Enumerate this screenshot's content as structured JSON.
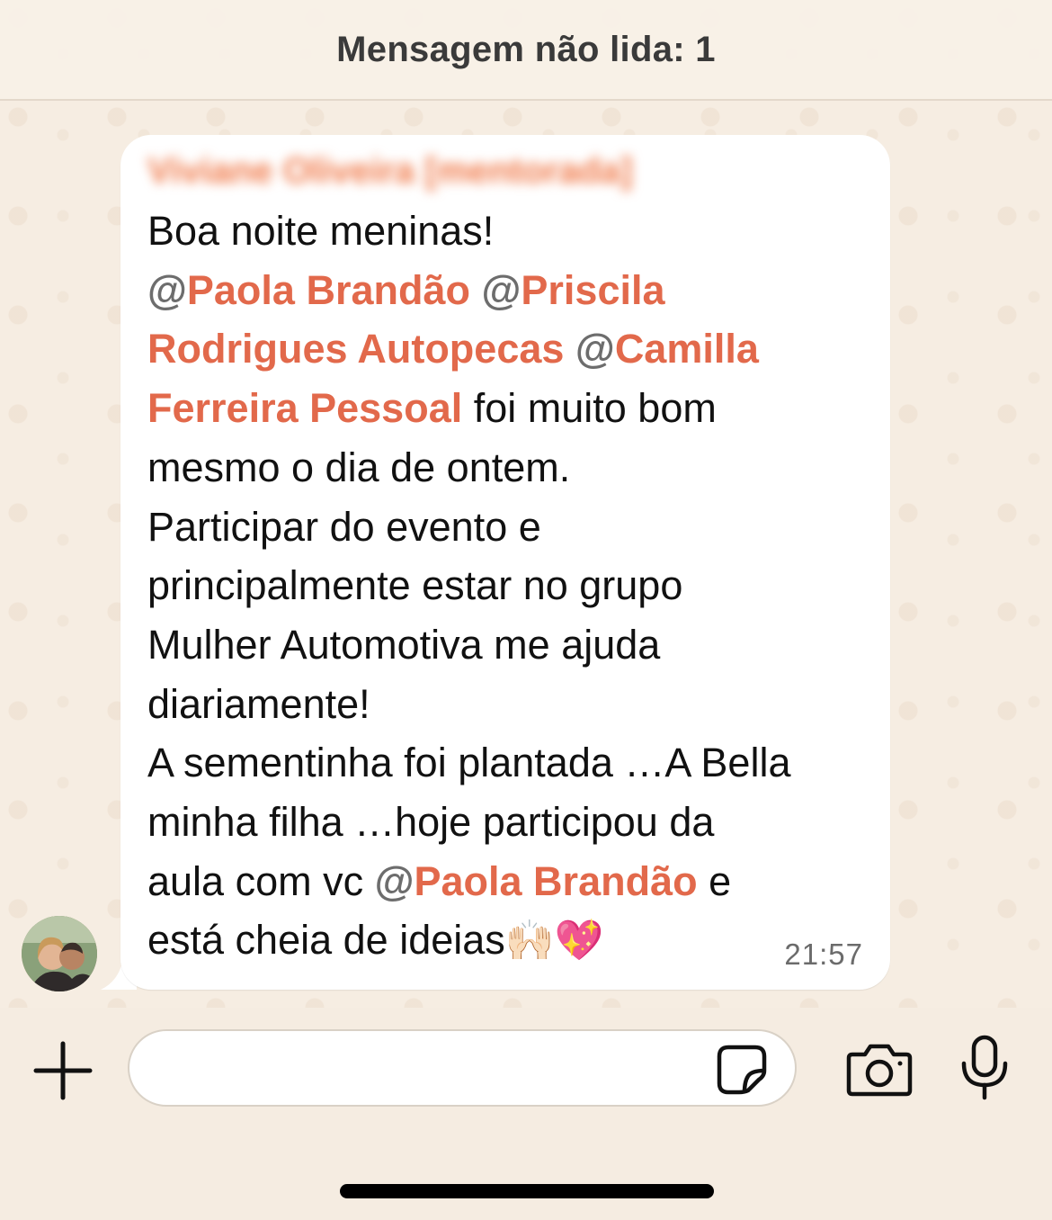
{
  "unread_banner": {
    "label": "Mensagem não lida: 1"
  },
  "message": {
    "sender": "Viviane Oliveira [mentorada]",
    "line1": "Boa noite meninas!",
    "mention_at": "@",
    "mention_paola": "Paola Brandão",
    "mention_priscila_1": "Priscila",
    "mention_priscila_2": "Rodrigues Autopecas",
    "mention_camilla_1": "Camilla",
    "mention_camilla_2": "Ferreira Pessoal",
    "after_mentions": " foi muito bom",
    "line5": "mesmo o dia de ontem.",
    "line6": "Participar do evento e",
    "line7": "principalmente estar no grupo",
    "line8": "Mulher Automotiva me ajuda",
    "line9": "diariamente!",
    "line10": "A sementinha foi plantada …A Bella",
    "line11": "minha filha …hoje participou da",
    "line12_prefix": "aula com vc ",
    "line12_suffix": " e",
    "line13": "está cheia de ideias",
    "emoji_hands": "🙌🏻",
    "emoji_heart": "💖",
    "time": "21:57"
  },
  "composer": {
    "placeholder": "",
    "icons": [
      "plus-icon",
      "sticker-icon",
      "camera-icon",
      "microphone-icon"
    ]
  },
  "colors": {
    "mention": "#E2694B",
    "sender": "#F07A4A",
    "bubble": "#FFFFFF",
    "wallpaper": "#F6EDE2"
  }
}
